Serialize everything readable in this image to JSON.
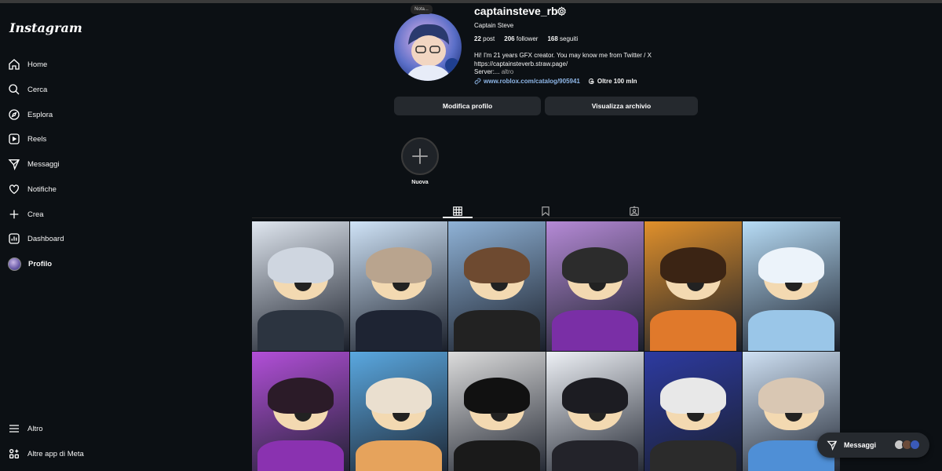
{
  "app": {
    "logo": "Instagram"
  },
  "sidebar": {
    "items": [
      {
        "label": "Home",
        "icon": "home-icon"
      },
      {
        "label": "Cerca",
        "icon": "search-icon"
      },
      {
        "label": "Esplora",
        "icon": "compass-icon"
      },
      {
        "label": "Reels",
        "icon": "reels-icon"
      },
      {
        "label": "Messaggi",
        "icon": "messenger-icon"
      },
      {
        "label": "Notifiche",
        "icon": "heart-icon"
      },
      {
        "label": "Crea",
        "icon": "plus-icon"
      },
      {
        "label": "Dashboard",
        "icon": "dashboard-icon"
      },
      {
        "label": "Profilo",
        "icon": "avatar"
      }
    ],
    "bottom": [
      {
        "label": "Altro",
        "icon": "menu-icon"
      },
      {
        "label": "Altre app di Meta",
        "icon": "meta-apps-icon"
      }
    ]
  },
  "profile": {
    "note": "Nota...",
    "username": "captainsteve_rb",
    "full_name": "Captain Steve",
    "posts_count": "22",
    "posts_label": "post",
    "followers_count": "206",
    "followers_label": "follower",
    "following_count": "168",
    "following_label": "seguiti",
    "bio_line1": "Hi! I'm 21 years GFX creator. You may know me from Twitter / X",
    "bio_line2": "https://captainsteverb.straw.page/",
    "bio_line3": "Server:...",
    "bio_more": "altro",
    "link": "www.roblox.com/catalog/905941",
    "threads": "Oltre 100 mln",
    "edit_button": "Modifica profilo",
    "archive_button": "Visualizza archivio"
  },
  "highlights": {
    "new_label": "Nuova"
  },
  "tabs": [
    {
      "icon": "grid-icon",
      "active": true
    },
    {
      "icon": "bookmark-icon",
      "active": false
    },
    {
      "icon": "tagged-icon",
      "active": false
    }
  ],
  "posts": [
    {
      "bg": "#dfe6ef",
      "hair": "#cfd6e0",
      "body": "#2c3440"
    },
    {
      "bg": "#cfe3f7",
      "hair": "#b9a48e",
      "body": "#1e2433"
    },
    {
      "bg": "#8fb2d6",
      "hair": "#6e4a30",
      "body": "#222222"
    },
    {
      "bg": "#b58ad6",
      "hair": "#2c2c2c",
      "body": "#7a2fa6"
    },
    {
      "bg": "#e0902b",
      "hair": "#3b2414",
      "body": "#e0792b"
    },
    {
      "bg": "#b7dcf6",
      "hair": "#ecf3fa",
      "body": "#9ac6e8"
    },
    {
      "bg": "#b24fd8",
      "hair": "#2b1b28",
      "body": "#8a32b0"
    },
    {
      "bg": "#5aa8e0",
      "hair": "#eadfcf",
      "body": "#e6a35c"
    },
    {
      "bg": "#dcdcdc",
      "hair": "#111111",
      "body": "#1a1a1a"
    },
    {
      "bg": "#eef1f6",
      "hair": "#1c1c22",
      "body": "#23232a"
    },
    {
      "bg": "#2d3aa0",
      "hair": "#e8e8e8",
      "body": "#2b2b2b"
    },
    {
      "bg": "#cfe1f4",
      "hair": "#d9c7b3",
      "body": "#4f8fd6"
    }
  ],
  "messages_pill": {
    "label": "Messaggi"
  },
  "colors": {
    "background": "#0c1014",
    "button": "#25292e",
    "link": "#8fb7e8"
  }
}
